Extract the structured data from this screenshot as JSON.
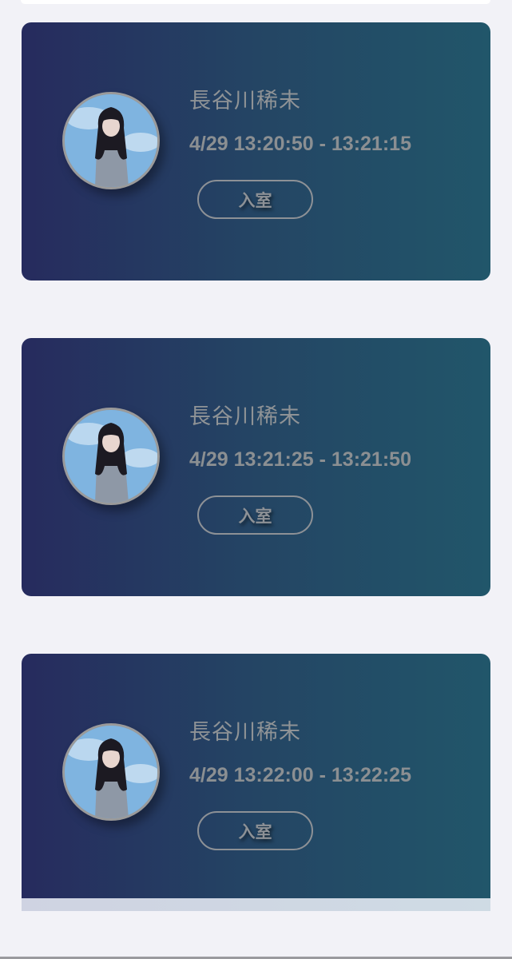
{
  "sessions": [
    {
      "name": "長谷川稀未",
      "time": "4/29 13:20:50 - 13:21:15",
      "button_label": "入室"
    },
    {
      "name": "長谷川稀未",
      "time": "4/29 13:21:25 - 13:21:50",
      "button_label": "入室"
    },
    {
      "name": "長谷川稀未",
      "time": "4/29 13:22:00 - 13:22:25",
      "button_label": "入室"
    }
  ],
  "colors": {
    "background": "#f2f2f7",
    "card_gradient_start": "#262b5e",
    "card_gradient_end": "#21566a",
    "text": "#8f9396"
  },
  "icons": {
    "avatar": "member-photo-avatar"
  }
}
